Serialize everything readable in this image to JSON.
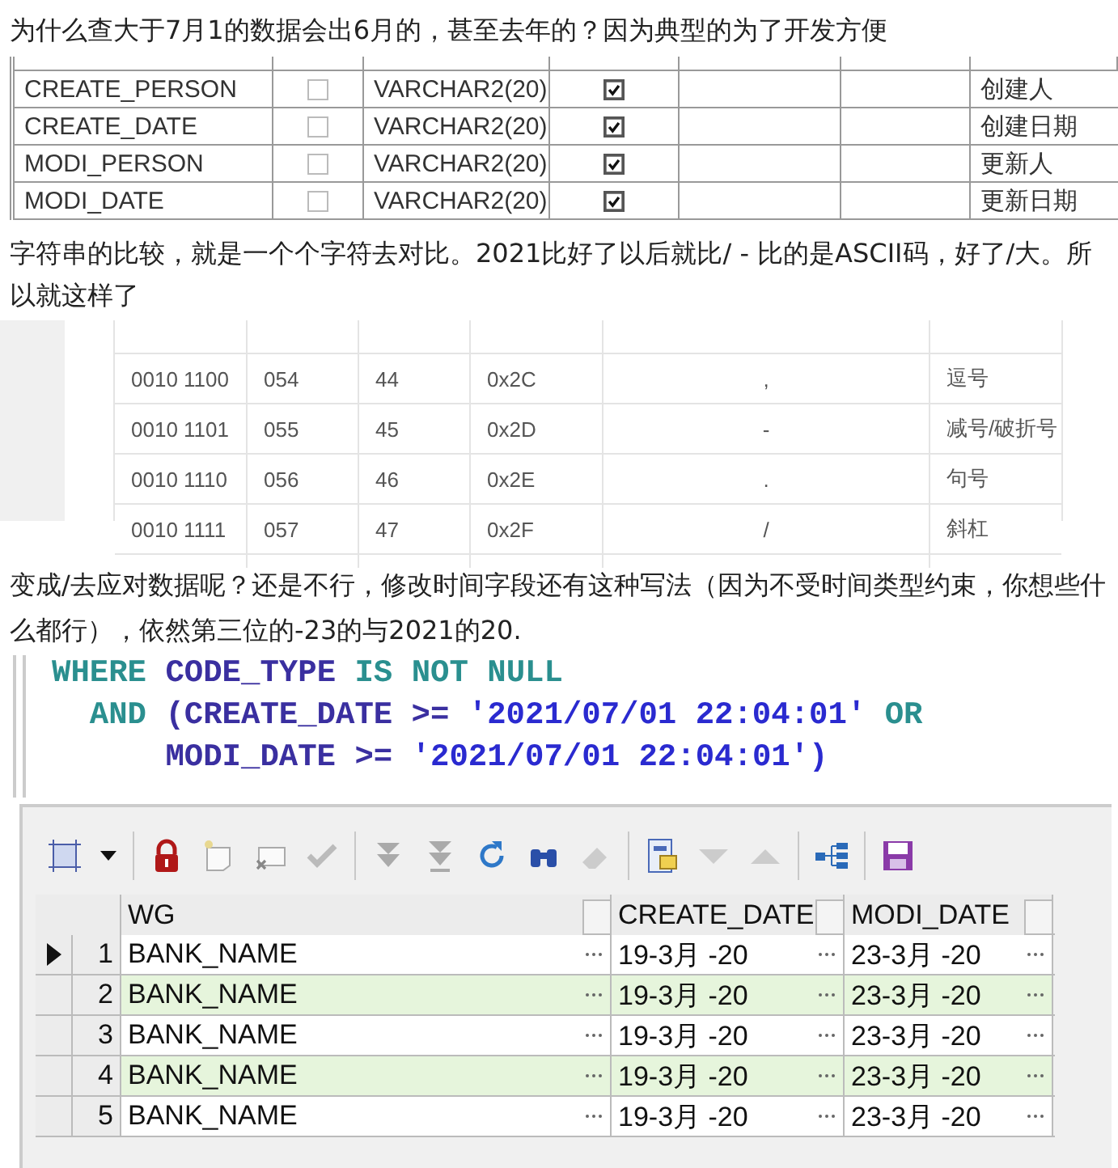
{
  "intro_text": "为什么查大于7月1的数据会出6月的，甚至去年的？因为典型的为了开发方便",
  "column_table": {
    "rows": [
      {
        "name": "CREATE_PERSON",
        "nullable": false,
        "type": "VARCHAR2(20)",
        "required": true,
        "comment": "创建人"
      },
      {
        "name": "CREATE_DATE",
        "nullable": false,
        "type": "VARCHAR2(20)",
        "required": true,
        "comment": "创建日期"
      },
      {
        "name": "MODI_PERSON",
        "nullable": false,
        "type": "VARCHAR2(20)",
        "required": true,
        "comment": "更新人"
      },
      {
        "name": "MODI_DATE",
        "nullable": false,
        "type": "VARCHAR2(20)",
        "required": true,
        "comment": "更新日期"
      }
    ]
  },
  "comparison_text": "字符串的比较，就是一个个字符去对比。2021比好了以后就比/  - 比的是ASCII码，好了/大。所以就这样了",
  "ascii_table": {
    "rows": [
      {
        "binary": "0010 1100",
        "octal": "054",
        "decimal": "44",
        "hex": "0x2C",
        "char": ",",
        "description": "逗号"
      },
      {
        "binary": "0010 1101",
        "octal": "055",
        "decimal": "45",
        "hex": "0x2D",
        "char": "-",
        "description": "减号/破折号"
      },
      {
        "binary": "0010 1110",
        "octal": "056",
        "decimal": "46",
        "hex": "0x2E",
        "char": ".",
        "description": "句号"
      },
      {
        "binary": "0010 1111",
        "octal": "057",
        "decimal": "47",
        "hex": "0x2F",
        "char": "/",
        "description": "斜杠"
      }
    ]
  },
  "conclusion_text": "变成/去应对数据呢？还是不行，修改时间字段还有这种写法（因为不受时间类型约束，你想些什么都行），依然第三位的-23的与2021的20.",
  "sql_code": {
    "lines": [
      [
        {
          "kind": "keyword",
          "text": "WHERE"
        },
        {
          "kind": "identifier",
          "text": "CODE_TYPE"
        },
        {
          "kind": "keyword",
          "text": "IS NOT NULL"
        }
      ],
      [
        {
          "kind": "keyword",
          "text": "AND"
        },
        {
          "kind": "identifier",
          "text": "(CREATE_DATE >="
        },
        {
          "kind": "string",
          "text": "'2021/07/01 22:04:01'"
        },
        {
          "kind": "keyword",
          "text": "OR"
        }
      ],
      [
        {
          "kind": "identifier",
          "text": "MODI_DATE >="
        },
        {
          "kind": "string",
          "text": "'2021/07/01 22:04:01')"
        }
      ]
    ]
  },
  "result_grid": {
    "columns": [
      "WG",
      "CREATE_DATE",
      "MODI_DATE"
    ],
    "rows": [
      {
        "number": "1",
        "selected": true,
        "cells": [
          "BANK_NAME",
          "19-3月 -20",
          "23-3月 -20"
        ]
      },
      {
        "number": "2",
        "selected": false,
        "cells": [
          "BANK_NAME",
          "19-3月 -20",
          "23-3月 -20"
        ]
      },
      {
        "number": "3",
        "selected": false,
        "cells": [
          "BANK_NAME",
          "19-3月 -20",
          "23-3月 -20"
        ]
      },
      {
        "number": "4",
        "selected": false,
        "cells": [
          "BANK_NAME",
          "19-3月 -20",
          "23-3月 -20"
        ]
      },
      {
        "number": "5",
        "selected": false,
        "cells": [
          "BANK_NAME",
          "19-3月 -20",
          "23-3月 -20"
        ]
      }
    ]
  }
}
